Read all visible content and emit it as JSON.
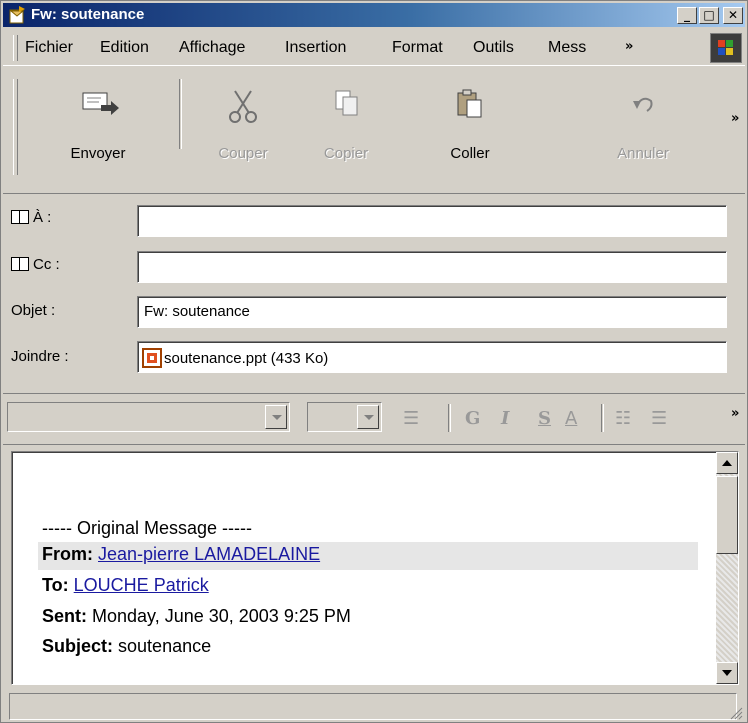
{
  "window": {
    "title": "Fw: soutenance",
    "min": "_",
    "max": "□",
    "close": "✕"
  },
  "menu": [
    {
      "label": "Fichier"
    },
    {
      "label": "Edition"
    },
    {
      "label": "Affichage"
    },
    {
      "label": "Insertion"
    },
    {
      "label": "Format"
    },
    {
      "label": "Outils"
    },
    {
      "label": "Mess"
    }
  ],
  "menu_more": "»",
  "toolbar": {
    "send": "Envoyer",
    "cut": "Couper",
    "copy": "Copier",
    "paste": "Coller",
    "undo": "Annuler",
    "more": "»"
  },
  "fields": {
    "to_label": "À :",
    "cc_label": "Cc :",
    "subject_label": "Objet :",
    "subject_value": "Fw: soutenance",
    "attach_label": "Joindre :",
    "attach_value": "soutenance.ppt (433 Ko)"
  },
  "format": {
    "bold": "G",
    "italic": "I",
    "underline": "S",
    "color": "A",
    "more": "»"
  },
  "message": {
    "separator": "----- Original Message -----",
    "from_label": "From:",
    "from_value": "Jean-pierre LAMADELAINE",
    "to_label": "To:",
    "to_value": "LOUCHE Patrick",
    "sent_label": "Sent:",
    "sent_value": "Monday, June 30, 2003 9:25 PM",
    "subject_label": "Subject:",
    "subject_value": "soutenance"
  }
}
